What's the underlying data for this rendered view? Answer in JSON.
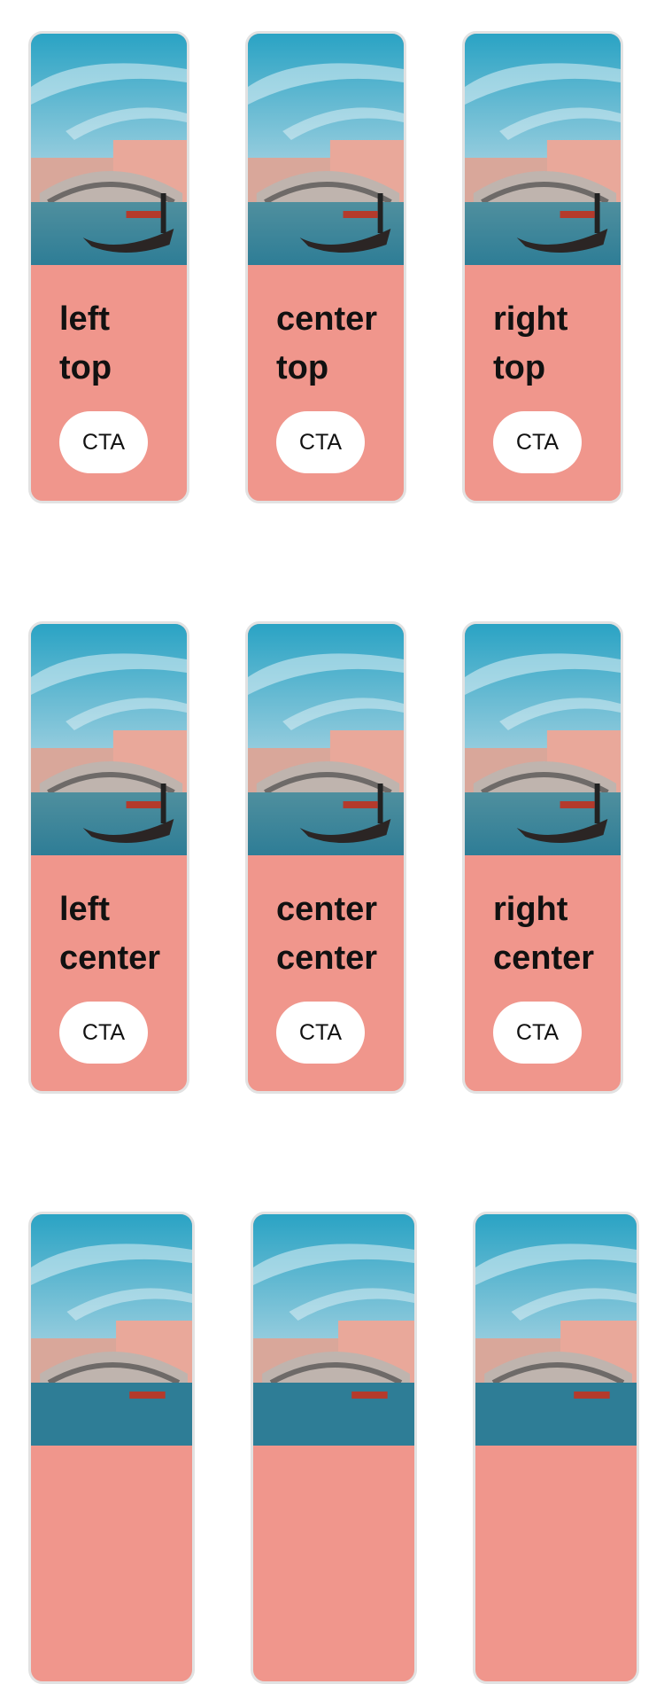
{
  "colors": {
    "card_background": "#f0968c",
    "card_border": "#e2e2e2",
    "button_background": "#ffffff",
    "text": "#111111"
  },
  "image_description_icon": "venice-gondola-photo",
  "cards": [
    {
      "title_line1": "left",
      "title_line2": "top",
      "cta": "CTA"
    },
    {
      "title_line1": "center",
      "title_line2": "top",
      "cta": "CTA"
    },
    {
      "title_line1": "right",
      "title_line2": "top",
      "cta": "CTA"
    },
    {
      "title_line1": "left",
      "title_line2": "center",
      "cta": "CTA"
    },
    {
      "title_line1": "center",
      "title_line2": "center",
      "cta": "CTA"
    },
    {
      "title_line1": "right",
      "title_line2": "center",
      "cta": "CTA"
    }
  ]
}
